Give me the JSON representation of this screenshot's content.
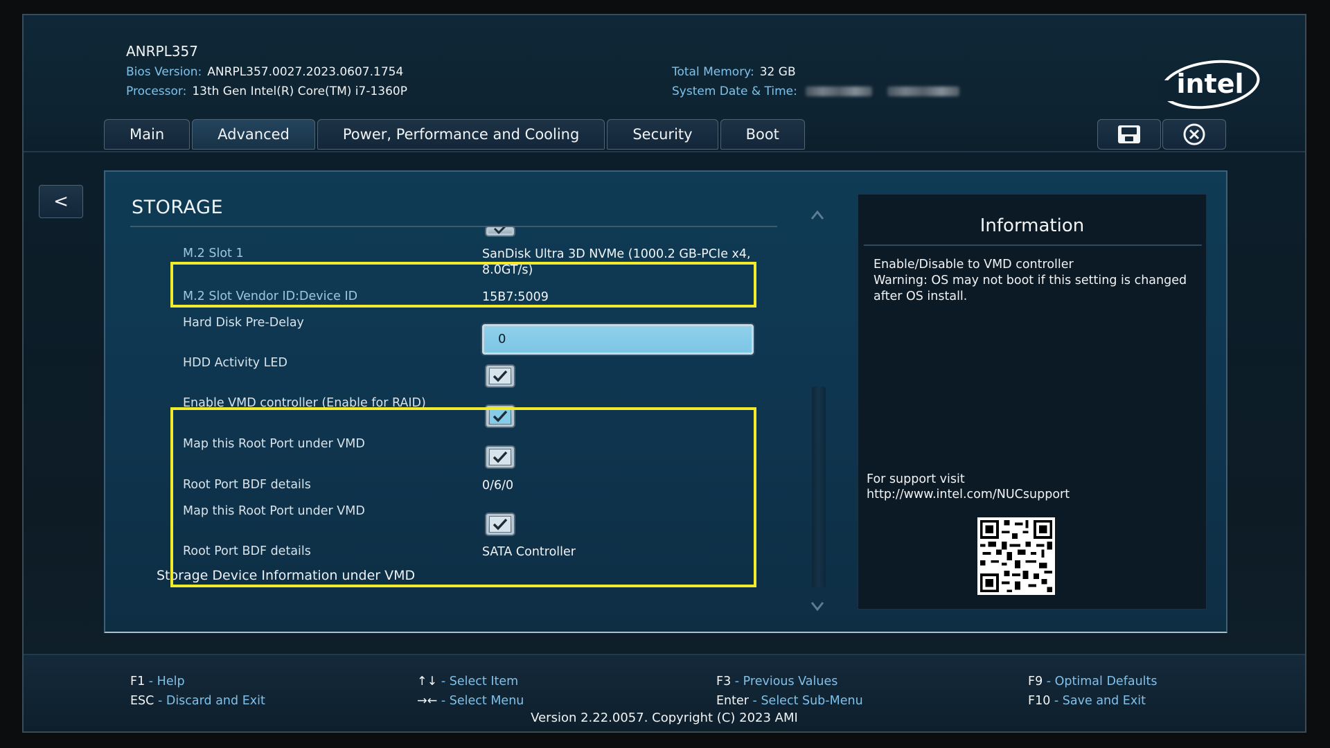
{
  "header": {
    "model": "ANRPL357",
    "bios_label": "Bios Version:",
    "bios_value": "ANRPL357.0027.2023.0607.1754",
    "processor_label": "Processor:",
    "processor_value": "13th Gen Intel(R) Core(TM) i7-1360P",
    "memory_label": "Total Memory:",
    "memory_value": "32 GB",
    "datetime_label": "System Date & Time:"
  },
  "brand": {
    "logo_text": "intel",
    "color": "#ffffff"
  },
  "tabs": [
    {
      "label": "Main"
    },
    {
      "label": "Advanced"
    },
    {
      "label": "Power, Performance and Cooling"
    },
    {
      "label": "Security"
    },
    {
      "label": "Boot"
    }
  ],
  "toolbar": {
    "save_icon": "floppy-disk-icon",
    "exit_icon": "close-circle-icon"
  },
  "nav": {
    "back_label": "<"
  },
  "section": {
    "title": "STORAGE",
    "rows": [
      {
        "label": "M.2 Slot 1",
        "value": "SanDisk Ultra 3D NVMe (1000.2 GB-PCIe x4, 8.0GT/s)"
      },
      {
        "label": "M.2 Slot Vendor ID:Device ID",
        "value": "15B7:5009"
      },
      {
        "label": "Hard Disk Pre-Delay",
        "value": "0"
      },
      {
        "label": "HDD Activity LED",
        "checked": true
      },
      {
        "label": "Enable VMD controller (Enable for RAID)",
        "checked": true
      },
      {
        "label": "Map this Root Port under VMD",
        "checked": true
      },
      {
        "label": "Root Port BDF details",
        "value": "0/6/0"
      },
      {
        "label": "Map this Root Port under VMD",
        "checked": true
      },
      {
        "label": "Root Port BDF details",
        "value": "SATA Controller"
      }
    ],
    "footer_heading": "Storage Device Information under VMD"
  },
  "info": {
    "title": "Information",
    "text": "Enable/Disable to VMD controller\nWarning: OS may not boot if this setting is changed after OS install.",
    "support_line1": "For support visit",
    "support_line2": "http://www.intel.com/NUCsupport"
  },
  "footer": {
    "keys": [
      {
        "key": "F1",
        "desc": "Help"
      },
      {
        "key": "ESC",
        "desc": "Discard and Exit"
      },
      {
        "key": "↑↓",
        "desc": "Select Item"
      },
      {
        "key": "→←",
        "desc": "Select Menu"
      },
      {
        "key": "F3",
        "desc": "Previous Values"
      },
      {
        "key": "Enter",
        "desc": "Select Sub-Menu"
      },
      {
        "key": "F9",
        "desc": "Optimal Defaults"
      },
      {
        "key": "F10",
        "desc": "Save and Exit"
      }
    ],
    "separator": " - ",
    "version": "Version 2.22.0057. Copyright (C) 2023 AMI"
  },
  "colors": {
    "highlight": "#f2ea2c",
    "accent_text": "#7fc2ea",
    "input_fill": "#8fd0ea"
  }
}
